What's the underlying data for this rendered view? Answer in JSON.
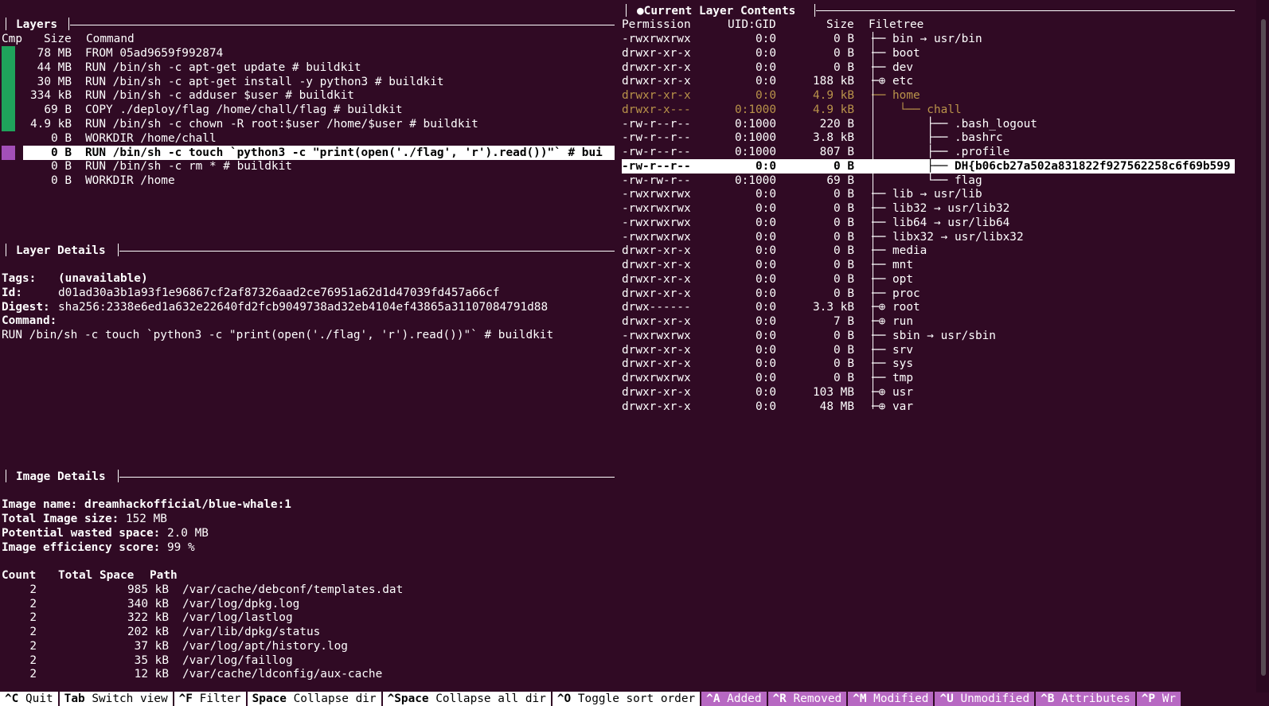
{
  "colors": {
    "bg": "#300a24",
    "added_bar": "#1fa35b",
    "current_bar": "#a34fb8",
    "dim": "#b9934a",
    "footer_purple": "#b768c2"
  },
  "layers": {
    "title": "Layers",
    "col_cmp": "Cmp",
    "col_size": "Size",
    "col_command": "Command",
    "rows": [
      {
        "size": "78 MB",
        "command": "FROM 05ad9659f992874"
      },
      {
        "size": "44 MB",
        "command": "RUN /bin/sh -c apt-get update # buildkit"
      },
      {
        "size": "30 MB",
        "command": "RUN /bin/sh -c apt-get install -y python3 # buildkit"
      },
      {
        "size": "334 kB",
        "command": "RUN /bin/sh -c adduser $user # buildkit"
      },
      {
        "size": "69 B",
        "command": "COPY ./deploy/flag /home/chall/flag # buildkit"
      },
      {
        "size": "4.9 kB",
        "command": "RUN /bin/sh -c chown -R root:$user /home/$user # buildkit"
      },
      {
        "size": "0 B",
        "command": "WORKDIR /home/chall"
      },
      {
        "size": "0 B",
        "command": "RUN /bin/sh -c touch `python3 -c \"print(open('./flag', 'r').read())\"` # bui"
      },
      {
        "size": "0 B",
        "command": "RUN /bin/sh -c rm * # buildkit"
      },
      {
        "size": "0 B",
        "command": "WORKDIR /home"
      }
    ]
  },
  "layer_details": {
    "title": "Layer Details",
    "tags_label": "Tags:",
    "tags_value": "(unavailable)",
    "id_label": "Id:",
    "id_value": "d01ad30a3b1a93f1e96867cf2af87326aad2ce76951a62d1d47039fd457a66cf",
    "digest_label": "Digest:",
    "digest_value": "sha256:2338e6ed1a632e22640fd2fcb9049738ad32eb4104ef43865a31107084791d88",
    "command_label": "Command:",
    "command_value": "RUN /bin/sh -c touch `python3 -c \"print(open('./flag', 'r').read())\"` # buildkit"
  },
  "image_details": {
    "title": "Image Details",
    "name_label": "Image name:",
    "name_value": "dreamhackofficial/blue-whale:1",
    "size_label": "Total Image size:",
    "size_value": "152 MB",
    "wasted_label": "Potential wasted space:",
    "wasted_value": "2.0 MB",
    "eff_label": "Image efficiency score:",
    "eff_value": "99 %",
    "col_count": "Count",
    "col_total": "Total Space",
    "col_path": "Path",
    "rows": [
      {
        "count": "2",
        "space": "985 kB",
        "path": "/var/cache/debconf/templates.dat"
      },
      {
        "count": "2",
        "space": "340 kB",
        "path": "/var/log/dpkg.log"
      },
      {
        "count": "2",
        "space": "322 kB",
        "path": "/var/log/lastlog"
      },
      {
        "count": "2",
        "space": "202 kB",
        "path": "/var/lib/dpkg/status"
      },
      {
        "count": "2",
        "space": "37 kB",
        "path": "/var/log/apt/history.log"
      },
      {
        "count": "2",
        "space": "35 kB",
        "path": "/var/log/faillog"
      },
      {
        "count": "2",
        "space": "12 kB",
        "path": "/var/cache/ldconfig/aux-cache"
      }
    ]
  },
  "contents": {
    "title": "Current Layer Contents",
    "col_perm": "Permission",
    "col_uid": "UID:GID",
    "col_size": "Size",
    "col_tree": "Filetree",
    "rows": [
      {
        "perm": "-rwxrwxrwx",
        "uid": "0:0",
        "size": "0 B",
        "tree": "── bin → usr/bin"
      },
      {
        "perm": "drwxr-xr-x",
        "uid": "0:0",
        "size": "0 B",
        "tree": "── boot"
      },
      {
        "perm": "drwxr-xr-x",
        "uid": "0:0",
        "size": "0 B",
        "tree": "── dev"
      },
      {
        "perm": "drwxr-xr-x",
        "uid": "0:0",
        "size": "188 kB",
        "tree": "─⊕ etc"
      },
      {
        "perm": "drwxr-xr-x",
        "uid": "0:0",
        "size": "4.9 kB",
        "tree": "── home"
      },
      {
        "perm": "drwxr-x---",
        "uid": "0:1000",
        "size": "4.9 kB",
        "tree": "    └── chall"
      },
      {
        "perm": "-rw-r--r--",
        "uid": "0:1000",
        "size": "220 B",
        "tree": "        ├── .bash_logout"
      },
      {
        "perm": "-rw-r--r--",
        "uid": "0:1000",
        "size": "3.8 kB",
        "tree": "        ├── .bashrc"
      },
      {
        "perm": "-rw-r--r--",
        "uid": "0:1000",
        "size": "807 B",
        "tree": "        ├── .profile"
      },
      {
        "perm": "-rw-r--r--",
        "uid": "0:0",
        "size": "0 B",
        "tree": "        ├── DH{b06cb27a502a831822f927562258c6f69b599"
      },
      {
        "perm": "-rw-rw-r--",
        "uid": "0:1000",
        "size": "69 B",
        "tree": "        └── flag"
      },
      {
        "perm": "-rwxrwxrwx",
        "uid": "0:0",
        "size": "0 B",
        "tree": "── lib → usr/lib"
      },
      {
        "perm": "-rwxrwxrwx",
        "uid": "0:0",
        "size": "0 B",
        "tree": "── lib32 → usr/lib32"
      },
      {
        "perm": "-rwxrwxrwx",
        "uid": "0:0",
        "size": "0 B",
        "tree": "── lib64 → usr/lib64"
      },
      {
        "perm": "-rwxrwxrwx",
        "uid": "0:0",
        "size": "0 B",
        "tree": "── libx32 → usr/libx32"
      },
      {
        "perm": "drwxr-xr-x",
        "uid": "0:0",
        "size": "0 B",
        "tree": "── media"
      },
      {
        "perm": "drwxr-xr-x",
        "uid": "0:0",
        "size": "0 B",
        "tree": "── mnt"
      },
      {
        "perm": "drwxr-xr-x",
        "uid": "0:0",
        "size": "0 B",
        "tree": "── opt"
      },
      {
        "perm": "drwxr-xr-x",
        "uid": "0:0",
        "size": "0 B",
        "tree": "── proc"
      },
      {
        "perm": "drwx------",
        "uid": "0:0",
        "size": "3.3 kB",
        "tree": "─⊕ root"
      },
      {
        "perm": "drwxr-xr-x",
        "uid": "0:0",
        "size": "7 B",
        "tree": "─⊕ run"
      },
      {
        "perm": "-rwxrwxrwx",
        "uid": "0:0",
        "size": "0 B",
        "tree": "── sbin → usr/sbin"
      },
      {
        "perm": "drwxr-xr-x",
        "uid": "0:0",
        "size": "0 B",
        "tree": "── srv"
      },
      {
        "perm": "drwxr-xr-x",
        "uid": "0:0",
        "size": "0 B",
        "tree": "── sys"
      },
      {
        "perm": "drwxrwxrwx",
        "uid": "0:0",
        "size": "0 B",
        "tree": "── tmp"
      },
      {
        "perm": "drwxr-xr-x",
        "uid": "0:0",
        "size": "103 MB",
        "tree": "─⊕ usr"
      },
      {
        "perm": "drwxr-xr-x",
        "uid": "0:0",
        "size": "48 MB",
        "tree": "─⊕ var"
      }
    ]
  },
  "footer": [
    {
      "key": "^C",
      "label": "Quit"
    },
    {
      "key": "Tab",
      "label": "Switch view"
    },
    {
      "key": "^F",
      "label": "Filter"
    },
    {
      "key": "Space",
      "label": "Collapse dir"
    },
    {
      "key": "^Space",
      "label": "Collapse all dir"
    },
    {
      "key": "^O",
      "label": "Toggle sort order"
    },
    {
      "key": "^A",
      "label": "Added"
    },
    {
      "key": "^R",
      "label": "Removed"
    },
    {
      "key": "^M",
      "label": "Modified"
    },
    {
      "key": "^U",
      "label": "Unmodified"
    },
    {
      "key": "^B",
      "label": "Attributes"
    },
    {
      "key": "^P",
      "label": "Wr"
    }
  ]
}
